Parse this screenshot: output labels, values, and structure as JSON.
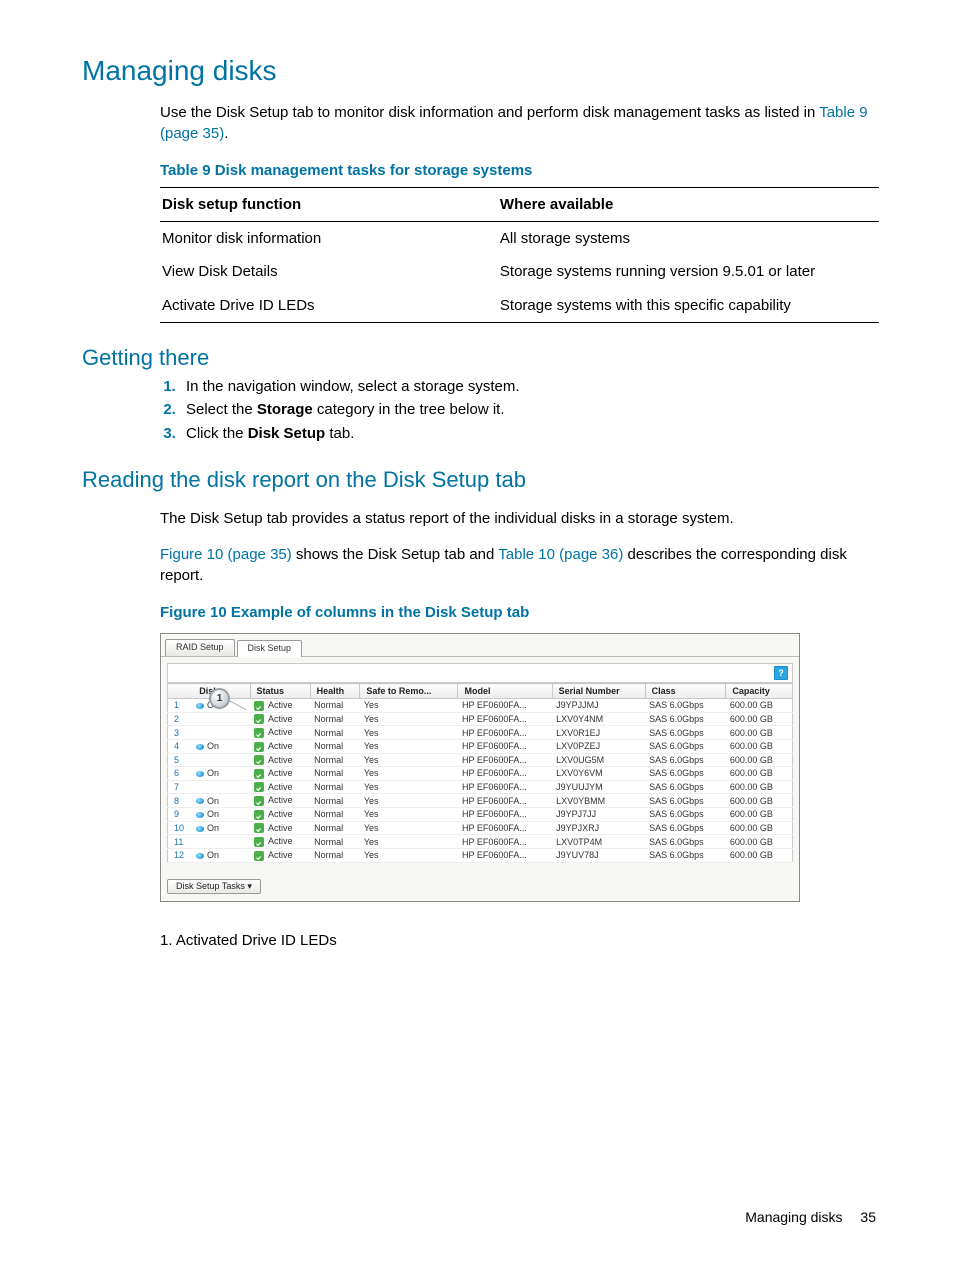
{
  "headings": {
    "main": "Managing disks",
    "getting_there": "Getting there",
    "reading": "Reading the disk report on the Disk Setup tab"
  },
  "intro": {
    "prefix": "Use the Disk Setup tab to monitor disk information and perform disk management tasks as listed in ",
    "link": "Table 9 (page 35)",
    "suffix": "."
  },
  "table9": {
    "caption": "Table 9 Disk management tasks for storage systems",
    "headers": {
      "c1": "Disk setup function",
      "c2": "Where available"
    },
    "rows": [
      {
        "c1": "Monitor disk information",
        "c2": "All storage systems"
      },
      {
        "c1": "View Disk Details",
        "c2": "Storage systems running version 9.5.01 or later"
      },
      {
        "c1": "Activate Drive ID LEDs",
        "c2": "Storage systems with this specific capability"
      }
    ]
  },
  "steps": {
    "s1": "In the navigation window, select a storage system.",
    "s2a": "Select the ",
    "s2b": "Storage",
    "s2c": " category in the tree below it.",
    "s3a": "Click the ",
    "s3b": "Disk Setup",
    "s3c": " tab."
  },
  "reading_para1": "The Disk Setup tab provides a status report of the individual disks in a storage system.",
  "reading_para2": {
    "l1": "Figure 10 (page 35)",
    "mid": " shows the Disk Setup tab and ",
    "l2": "Table 10 (page 36)",
    "suffix": " describes the corresponding disk report."
  },
  "figure": {
    "caption": "Figure 10 Example of columns in the Disk Setup tab",
    "tabs": {
      "raid": "RAID Setup",
      "disk": "Disk Setup"
    },
    "headers": [
      "Disk",
      "Status",
      "Health",
      "Safe to Remo...",
      "Model",
      "Serial Number",
      "Class",
      "Capacity"
    ],
    "status_label": "Active",
    "rows": [
      {
        "idx": "1",
        "on": "On",
        "health": "Normal",
        "safe": "Yes",
        "model": "HP EF0600FA...",
        "serial": "J9YPJJMJ",
        "class": "SAS 6.0Gbps",
        "cap": "600.00 GB"
      },
      {
        "idx": "2",
        "on": "",
        "health": "Normal",
        "safe": "Yes",
        "model": "HP EF0600FA...",
        "serial": "LXV0Y4NM",
        "class": "SAS 6.0Gbps",
        "cap": "600.00 GB"
      },
      {
        "idx": "3",
        "on": "",
        "health": "Normal",
        "safe": "Yes",
        "model": "HP EF0600FA...",
        "serial": "LXV0R1EJ",
        "class": "SAS 6.0Gbps",
        "cap": "600.00 GB"
      },
      {
        "idx": "4",
        "on": "On",
        "health": "Normal",
        "safe": "Yes",
        "model": "HP EF0600FA...",
        "serial": "LXV0PZEJ",
        "class": "SAS 6.0Gbps",
        "cap": "600.00 GB"
      },
      {
        "idx": "5",
        "on": "",
        "health": "Normal",
        "safe": "Yes",
        "model": "HP EF0600FA...",
        "serial": "LXV0UG5M",
        "class": "SAS 6.0Gbps",
        "cap": "600.00 GB"
      },
      {
        "idx": "6",
        "on": "On",
        "health": "Normal",
        "safe": "Yes",
        "model": "HP EF0600FA...",
        "serial": "LXV0Y6VM",
        "class": "SAS 6.0Gbps",
        "cap": "600.00 GB"
      },
      {
        "idx": "7",
        "on": "",
        "health": "Normal",
        "safe": "Yes",
        "model": "HP EF0600FA...",
        "serial": "J9YUUJYM",
        "class": "SAS 6.0Gbps",
        "cap": "600.00 GB"
      },
      {
        "idx": "8",
        "on": "On",
        "health": "Normal",
        "safe": "Yes",
        "model": "HP EF0600FA...",
        "serial": "LXV0YBMM",
        "class": "SAS 6.0Gbps",
        "cap": "600.00 GB"
      },
      {
        "idx": "9",
        "on": "On",
        "health": "Normal",
        "safe": "Yes",
        "model": "HP EF0600FA...",
        "serial": "J9YPJ7JJ",
        "class": "SAS 6.0Gbps",
        "cap": "600.00 GB"
      },
      {
        "idx": "10",
        "on": "On",
        "health": "Normal",
        "safe": "Yes",
        "model": "HP EF0600FA...",
        "serial": "J9YPJXRJ",
        "class": "SAS 6.0Gbps",
        "cap": "600.00 GB"
      },
      {
        "idx": "11",
        "on": "",
        "health": "Normal",
        "safe": "Yes",
        "model": "HP EF0600FA...",
        "serial": "LXV0TP4M",
        "class": "SAS 6.0Gbps",
        "cap": "600.00 GB"
      },
      {
        "idx": "12",
        "on": "On",
        "health": "Normal",
        "safe": "Yes",
        "model": "HP EF0600FA...",
        "serial": "J9YUV78J",
        "class": "SAS 6.0Gbps",
        "cap": "600.00 GB"
      }
    ],
    "callout_num": "1",
    "tasks_button": "Disk Setup Tasks ▾",
    "legend": "1. Activated Drive ID LEDs"
  },
  "footer": {
    "label": "Managing disks",
    "page": "35"
  }
}
